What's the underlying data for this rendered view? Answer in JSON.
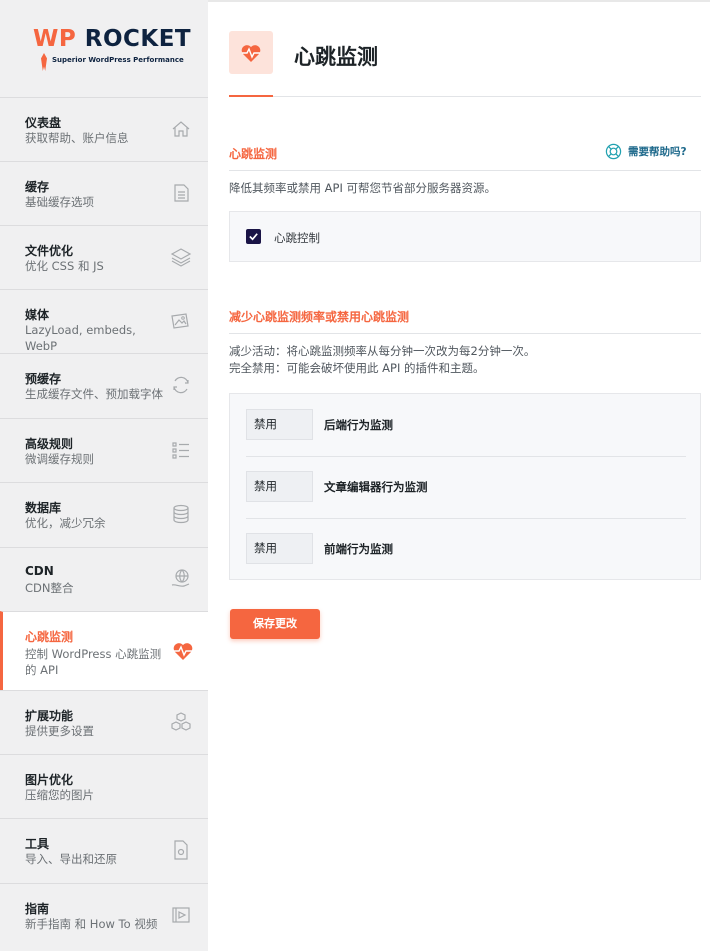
{
  "brand": {
    "logo_main_prefix": "WP",
    "logo_main_rest": " ROCKET",
    "logo_sub": "Superior WordPress Performance",
    "accent": "#f56640"
  },
  "sidebar": {
    "items": [
      {
        "title": "仪表盘",
        "desc": "获取帮助、账户信息",
        "icon": "house-icon"
      },
      {
        "title": "缓存",
        "desc": "基础缓存选项",
        "icon": "document-icon"
      },
      {
        "title": "文件优化",
        "desc": "优化 CSS 和 JS",
        "icon": "layers-icon"
      },
      {
        "title": "媒体",
        "desc": "LazyLoad, embeds, WebP",
        "icon": "images-icon"
      },
      {
        "title": "预缓存",
        "desc": "生成缓存文件、预加载字体",
        "icon": "refresh-icon"
      },
      {
        "title": "高级规则",
        "desc": "微调缓存规则",
        "icon": "list-icon"
      },
      {
        "title": "数据库",
        "desc": "优化，减少冗余",
        "icon": "database-icon"
      },
      {
        "title": "CDN",
        "desc": "CDN整合",
        "icon": "globe-hand-icon"
      },
      {
        "title": "心跳监测",
        "desc": "控制 WordPress 心跳监测的 API",
        "icon": "heartbeat-icon"
      },
      {
        "title": "扩展功能",
        "desc": "提供更多设置",
        "icon": "cubes-icon"
      },
      {
        "title": "图片优化",
        "desc": "压缩您的图片",
        "icon": "none"
      },
      {
        "title": "工具",
        "desc": "导入、导出和还原",
        "icon": "file-gear-icon"
      },
      {
        "title": "指南",
        "desc": "新手指南 和 How To 视频",
        "icon": "play-icon"
      }
    ]
  },
  "header": {
    "title": "心跳监测",
    "icon": "heartbeat-icon"
  },
  "section1": {
    "title": "心跳监测",
    "help_label": "需要帮助吗?",
    "description": "降低其频率或禁用 API 可帮您节省部分服务器资源。",
    "checkbox_label": "心跳控制",
    "checkbox_checked": true
  },
  "section2": {
    "title": "减少心跳监测频率或禁用心跳监测",
    "desc_line1": "减少活动：将心跳监测频率从每分钟一次改为每2分钟一次。",
    "desc_line2": "完全禁用：可能会破坏使用此 API 的插件和主题。",
    "rows": [
      {
        "value": "禁用",
        "label": "后端行为监测"
      },
      {
        "value": "禁用",
        "label": "文章编辑器行为监测"
      },
      {
        "value": "禁用",
        "label": "前端行为监测"
      }
    ]
  },
  "save_label": "保存更改"
}
